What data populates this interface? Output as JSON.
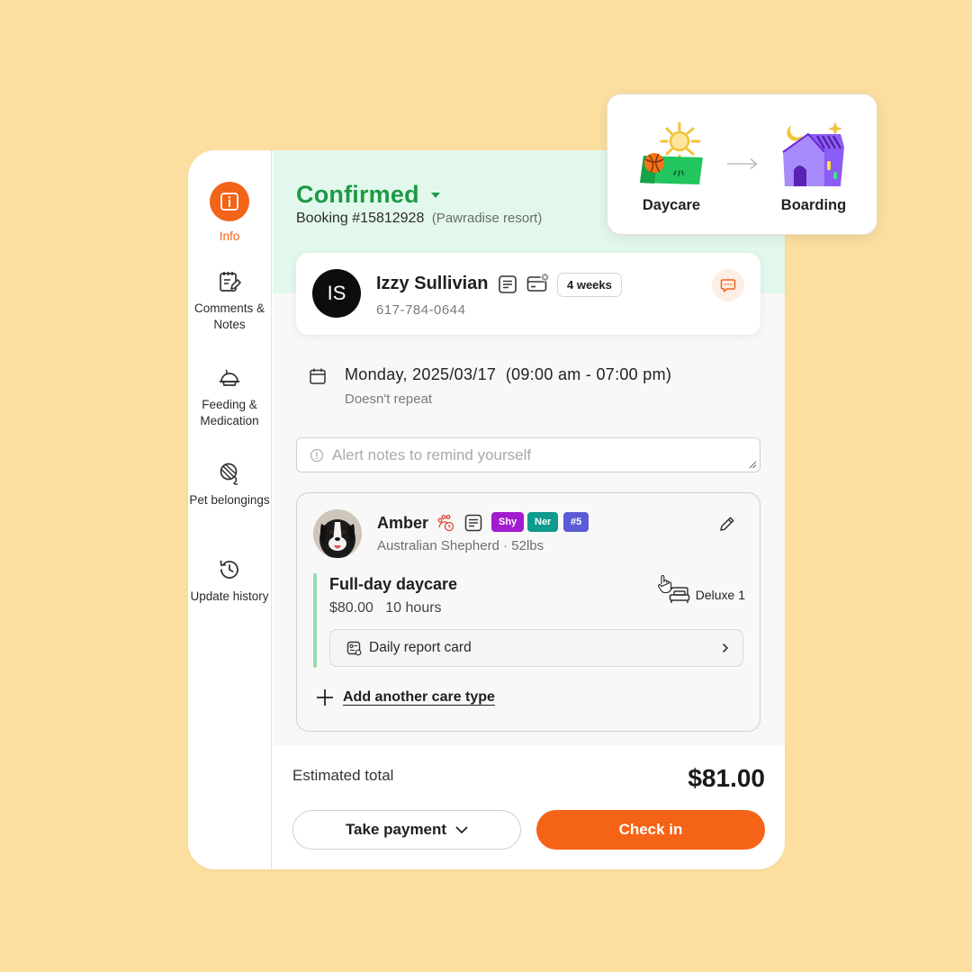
{
  "sidebar": {
    "items": [
      {
        "label": "Info",
        "icon": "info-icon",
        "active": true
      },
      {
        "label": "Comments & Notes",
        "icon": "notes-icon"
      },
      {
        "label": "Feeding & Medication",
        "icon": "bowl-icon"
      },
      {
        "label": "Pet belongings",
        "icon": "yarn-icon"
      },
      {
        "label": "Update history",
        "icon": "history-icon"
      }
    ]
  },
  "header": {
    "status": "Confirmed",
    "booking_number": "Booking #15812928",
    "resort": "(Pawradise resort)"
  },
  "client": {
    "initials": "IS",
    "name": "Izzy Sullivian",
    "phone": "617-784-0644",
    "duration_badge": "4 weeks"
  },
  "schedule": {
    "date": "Monday, 2025/03/17",
    "time": "(09:00 am - 07:00 pm)",
    "repeat": "Doesn't repeat"
  },
  "alert_notes": {
    "placeholder": "Alert notes to remind yourself"
  },
  "pet": {
    "name": "Amber",
    "breed": "Australian Shepherd · 52lbs",
    "tags": [
      {
        "label": "Shy",
        "color": "#a21ccf"
      },
      {
        "label": "Ner",
        "color": "#0f9b8e"
      },
      {
        "label": "#5",
        "color": "#5b5bd6"
      }
    ]
  },
  "service": {
    "name": "Full-day daycare",
    "price": "$80.00",
    "duration": "10 hours",
    "room": "Deluxe 1",
    "report_card": "Daily report card",
    "add_care_label": "Add another care type"
  },
  "footer": {
    "estimated_label": "Estimated total",
    "estimated_value": "$81.00",
    "take_payment_label": "Take payment",
    "check_in_label": "Check in"
  },
  "transition": {
    "from": "Daycare",
    "to": "Boarding"
  },
  "colors": {
    "accent": "#f56317",
    "status_green": "#1c9a46",
    "background": "#fbdea0"
  }
}
